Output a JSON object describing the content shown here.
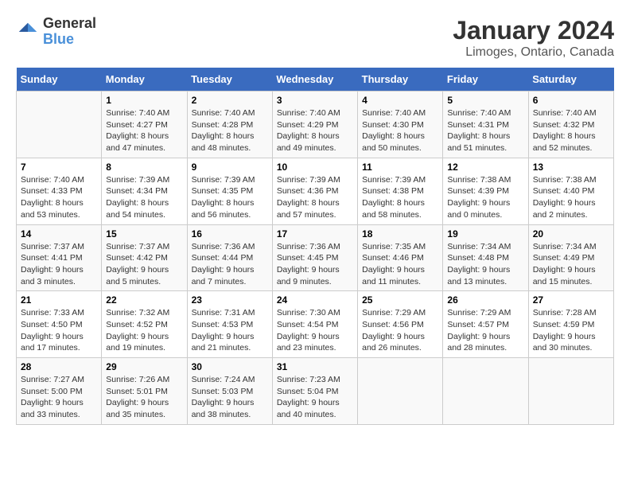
{
  "logo": {
    "general": "General",
    "blue": "Blue"
  },
  "title": "January 2024",
  "subtitle": "Limoges, Ontario, Canada",
  "weekdays": [
    "Sunday",
    "Monday",
    "Tuesday",
    "Wednesday",
    "Thursday",
    "Friday",
    "Saturday"
  ],
  "weeks": [
    [
      {
        "day": "",
        "sunrise": "",
        "sunset": "",
        "daylight": ""
      },
      {
        "day": "1",
        "sunrise": "Sunrise: 7:40 AM",
        "sunset": "Sunset: 4:27 PM",
        "daylight": "Daylight: 8 hours and 47 minutes."
      },
      {
        "day": "2",
        "sunrise": "Sunrise: 7:40 AM",
        "sunset": "Sunset: 4:28 PM",
        "daylight": "Daylight: 8 hours and 48 minutes."
      },
      {
        "day": "3",
        "sunrise": "Sunrise: 7:40 AM",
        "sunset": "Sunset: 4:29 PM",
        "daylight": "Daylight: 8 hours and 49 minutes."
      },
      {
        "day": "4",
        "sunrise": "Sunrise: 7:40 AM",
        "sunset": "Sunset: 4:30 PM",
        "daylight": "Daylight: 8 hours and 50 minutes."
      },
      {
        "day": "5",
        "sunrise": "Sunrise: 7:40 AM",
        "sunset": "Sunset: 4:31 PM",
        "daylight": "Daylight: 8 hours and 51 minutes."
      },
      {
        "day": "6",
        "sunrise": "Sunrise: 7:40 AM",
        "sunset": "Sunset: 4:32 PM",
        "daylight": "Daylight: 8 hours and 52 minutes."
      }
    ],
    [
      {
        "day": "7",
        "sunrise": "Sunrise: 7:40 AM",
        "sunset": "Sunset: 4:33 PM",
        "daylight": "Daylight: 8 hours and 53 minutes."
      },
      {
        "day": "8",
        "sunrise": "Sunrise: 7:39 AM",
        "sunset": "Sunset: 4:34 PM",
        "daylight": "Daylight: 8 hours and 54 minutes."
      },
      {
        "day": "9",
        "sunrise": "Sunrise: 7:39 AM",
        "sunset": "Sunset: 4:35 PM",
        "daylight": "Daylight: 8 hours and 56 minutes."
      },
      {
        "day": "10",
        "sunrise": "Sunrise: 7:39 AM",
        "sunset": "Sunset: 4:36 PM",
        "daylight": "Daylight: 8 hours and 57 minutes."
      },
      {
        "day": "11",
        "sunrise": "Sunrise: 7:39 AM",
        "sunset": "Sunset: 4:38 PM",
        "daylight": "Daylight: 8 hours and 58 minutes."
      },
      {
        "day": "12",
        "sunrise": "Sunrise: 7:38 AM",
        "sunset": "Sunset: 4:39 PM",
        "daylight": "Daylight: 9 hours and 0 minutes."
      },
      {
        "day": "13",
        "sunrise": "Sunrise: 7:38 AM",
        "sunset": "Sunset: 4:40 PM",
        "daylight": "Daylight: 9 hours and 2 minutes."
      }
    ],
    [
      {
        "day": "14",
        "sunrise": "Sunrise: 7:37 AM",
        "sunset": "Sunset: 4:41 PM",
        "daylight": "Daylight: 9 hours and 3 minutes."
      },
      {
        "day": "15",
        "sunrise": "Sunrise: 7:37 AM",
        "sunset": "Sunset: 4:42 PM",
        "daylight": "Daylight: 9 hours and 5 minutes."
      },
      {
        "day": "16",
        "sunrise": "Sunrise: 7:36 AM",
        "sunset": "Sunset: 4:44 PM",
        "daylight": "Daylight: 9 hours and 7 minutes."
      },
      {
        "day": "17",
        "sunrise": "Sunrise: 7:36 AM",
        "sunset": "Sunset: 4:45 PM",
        "daylight": "Daylight: 9 hours and 9 minutes."
      },
      {
        "day": "18",
        "sunrise": "Sunrise: 7:35 AM",
        "sunset": "Sunset: 4:46 PM",
        "daylight": "Daylight: 9 hours and 11 minutes."
      },
      {
        "day": "19",
        "sunrise": "Sunrise: 7:34 AM",
        "sunset": "Sunset: 4:48 PM",
        "daylight": "Daylight: 9 hours and 13 minutes."
      },
      {
        "day": "20",
        "sunrise": "Sunrise: 7:34 AM",
        "sunset": "Sunset: 4:49 PM",
        "daylight": "Daylight: 9 hours and 15 minutes."
      }
    ],
    [
      {
        "day": "21",
        "sunrise": "Sunrise: 7:33 AM",
        "sunset": "Sunset: 4:50 PM",
        "daylight": "Daylight: 9 hours and 17 minutes."
      },
      {
        "day": "22",
        "sunrise": "Sunrise: 7:32 AM",
        "sunset": "Sunset: 4:52 PM",
        "daylight": "Daylight: 9 hours and 19 minutes."
      },
      {
        "day": "23",
        "sunrise": "Sunrise: 7:31 AM",
        "sunset": "Sunset: 4:53 PM",
        "daylight": "Daylight: 9 hours and 21 minutes."
      },
      {
        "day": "24",
        "sunrise": "Sunrise: 7:30 AM",
        "sunset": "Sunset: 4:54 PM",
        "daylight": "Daylight: 9 hours and 23 minutes."
      },
      {
        "day": "25",
        "sunrise": "Sunrise: 7:29 AM",
        "sunset": "Sunset: 4:56 PM",
        "daylight": "Daylight: 9 hours and 26 minutes."
      },
      {
        "day": "26",
        "sunrise": "Sunrise: 7:29 AM",
        "sunset": "Sunset: 4:57 PM",
        "daylight": "Daylight: 9 hours and 28 minutes."
      },
      {
        "day": "27",
        "sunrise": "Sunrise: 7:28 AM",
        "sunset": "Sunset: 4:59 PM",
        "daylight": "Daylight: 9 hours and 30 minutes."
      }
    ],
    [
      {
        "day": "28",
        "sunrise": "Sunrise: 7:27 AM",
        "sunset": "Sunset: 5:00 PM",
        "daylight": "Daylight: 9 hours and 33 minutes."
      },
      {
        "day": "29",
        "sunrise": "Sunrise: 7:26 AM",
        "sunset": "Sunset: 5:01 PM",
        "daylight": "Daylight: 9 hours and 35 minutes."
      },
      {
        "day": "30",
        "sunrise": "Sunrise: 7:24 AM",
        "sunset": "Sunset: 5:03 PM",
        "daylight": "Daylight: 9 hours and 38 minutes."
      },
      {
        "day": "31",
        "sunrise": "Sunrise: 7:23 AM",
        "sunset": "Sunset: 5:04 PM",
        "daylight": "Daylight: 9 hours and 40 minutes."
      },
      {
        "day": "",
        "sunrise": "",
        "sunset": "",
        "daylight": ""
      },
      {
        "day": "",
        "sunrise": "",
        "sunset": "",
        "daylight": ""
      },
      {
        "day": "",
        "sunrise": "",
        "sunset": "",
        "daylight": ""
      }
    ]
  ]
}
